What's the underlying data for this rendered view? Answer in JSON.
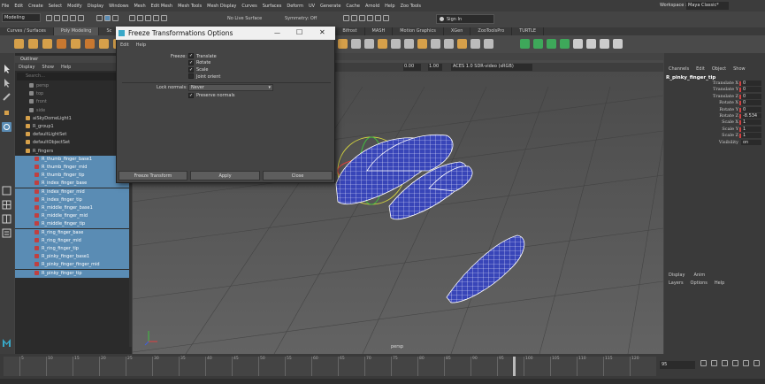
{
  "menubar": [
    "File",
    "Edit",
    "Create",
    "Select",
    "Modify",
    "Display",
    "Windows",
    "Mesh",
    "Edit Mesh",
    "Mesh Tools",
    "Mesh Display",
    "Curves",
    "Surfaces",
    "Deform",
    "UV",
    "Generate",
    "Cache",
    "Arnold",
    "Help",
    "Zoo Tools"
  ],
  "workspace": {
    "label": "Workspace :",
    "value": "Maya Classic*"
  },
  "status": {
    "mode": "Modeling",
    "live_surface": "No Live Surface",
    "symmetry": "Symmetry: Off",
    "sign_in": "Sign In"
  },
  "shelf_tabs": [
    "Curves / Surfaces",
    "Poly Modeling",
    "Sc",
    "Bifrost",
    "MASH",
    "Motion Graphics",
    "XGen",
    "ZooToolsPro",
    "TURTLE"
  ],
  "outliner": {
    "title": "Outliner",
    "menu": [
      "Display",
      "Show",
      "Help"
    ],
    "search": "Search...",
    "rows": [
      {
        "label": "persp",
        "sel": false,
        "dim": true
      },
      {
        "label": "top",
        "sel": false,
        "dim": true
      },
      {
        "label": "front",
        "sel": false,
        "dim": true
      },
      {
        "label": "side",
        "sel": false,
        "dim": true
      },
      {
        "label": "aiSkyDomeLight1",
        "sel": false,
        "dim": false
      },
      {
        "label": "R_group1",
        "sel": false,
        "dim": false
      },
      {
        "label": "defaultLightSet",
        "sel": false,
        "dim": false
      },
      {
        "label": "defaultObjectSet",
        "sel": false,
        "dim": false
      },
      {
        "label": "R_fingers",
        "sel": false,
        "dim": false
      },
      {
        "label": "R_thumb_finger_base1",
        "sel": true
      },
      {
        "label": "R_thumb_finger_mid",
        "sel": true
      },
      {
        "label": "R_thumb_finger_tip",
        "sel": true
      },
      {
        "label": "R_index_finger_base",
        "sel": true
      },
      {
        "label": "R_index_finger_mid",
        "sel": true
      },
      {
        "label": "R_index_finger_tip",
        "sel": true
      },
      {
        "label": "R_middle_finger_base1",
        "sel": true
      },
      {
        "label": "R_middle_finger_mid",
        "sel": true
      },
      {
        "label": "R_middle_finger_tip",
        "sel": true
      },
      {
        "label": "R_ring_finger_base",
        "sel": true
      },
      {
        "label": "R_ring_finger_mid",
        "sel": true
      },
      {
        "label": "R_ring_finger_tip",
        "sel": true
      },
      {
        "label": "R_pinky_finger_base1",
        "sel": true
      },
      {
        "label": "R_pinky_finger_finger_mid",
        "sel": true
      },
      {
        "label": "R_pinky_finger_tip",
        "sel": true
      }
    ]
  },
  "viewport": {
    "exposure": "0.00",
    "gamma": "1.00",
    "color_space": "ACES 1.0 SDR-video (sRGB)",
    "camera": "persp"
  },
  "channelbox": {
    "menu": [
      "Channels",
      "Edit",
      "Object",
      "Show"
    ],
    "object": "R_pinky_finger_tip",
    "rows": [
      {
        "label": "Translate X",
        "value": "0"
      },
      {
        "label": "Translate Y",
        "value": "0"
      },
      {
        "label": "Translate Z",
        "value": "0"
      },
      {
        "label": "Rotate X",
        "value": "0"
      },
      {
        "label": "Rotate Y",
        "value": "0"
      },
      {
        "label": "Rotate Z",
        "value": "-8.534"
      },
      {
        "label": "Scale X",
        "value": "1"
      },
      {
        "label": "Scale Y",
        "value": "1"
      },
      {
        "label": "Scale Z",
        "value": "1"
      },
      {
        "label": "Visibility",
        "value": "on"
      }
    ],
    "layer_tabs": [
      "Display",
      "Anim"
    ],
    "layer_menu": [
      "Layers",
      "Options",
      "Help"
    ]
  },
  "timeline": {
    "current_frame": "95",
    "ticks": [
      "5",
      "10",
      "15",
      "20",
      "25",
      "30",
      "35",
      "40",
      "45",
      "50",
      "55",
      "60",
      "65",
      "70",
      "75",
      "80",
      "85",
      "90",
      "95",
      "100",
      "105",
      "110",
      "115",
      "120"
    ]
  },
  "dialog": {
    "title": "Freeze Transformations Options",
    "menu": [
      "Edit",
      "Help"
    ],
    "freeze_label": "Freeze:",
    "options": [
      {
        "label": "Translate",
        "checked": true
      },
      {
        "label": "Rotate",
        "checked": true
      },
      {
        "label": "Scale",
        "checked": true
      },
      {
        "label": "Joint orient",
        "checked": false
      }
    ],
    "lock_label": "Lock normals:",
    "lock_value": "Never",
    "preserve_label": "Preserve normals",
    "preserve_checked": true,
    "buttons": {
      "freeze": "Freeze Transform",
      "apply": "Apply",
      "close": "Close"
    },
    "window_controls": {
      "minimize": "—",
      "maximize": "☐",
      "close": "✕"
    }
  }
}
